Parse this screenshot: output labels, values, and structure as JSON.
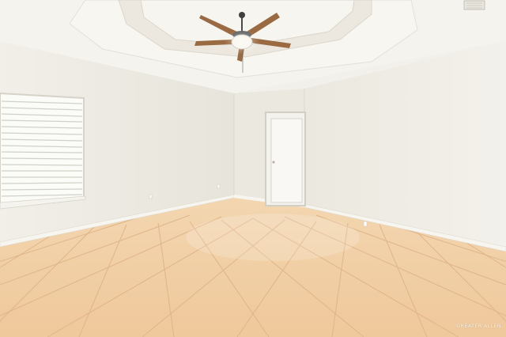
{
  "scene": {
    "subject": "empty-room",
    "features": [
      "tray-ceiling",
      "ceiling-fan",
      "window-with-blinds",
      "open-door",
      "tile-floor",
      "baseboards"
    ]
  },
  "watermark": {
    "text": "GREATER ALLEN"
  },
  "colors": {
    "wall_left": "#eeebe3",
    "wall_back": "#ece9e0",
    "wall_right": "#f1efe8",
    "ceiling": "#f6f4ef",
    "floor_tile": "#f1cda3",
    "grout": "#e3b98f",
    "fan_blade": "#9a6a43",
    "door": "#f8f7f3"
  }
}
